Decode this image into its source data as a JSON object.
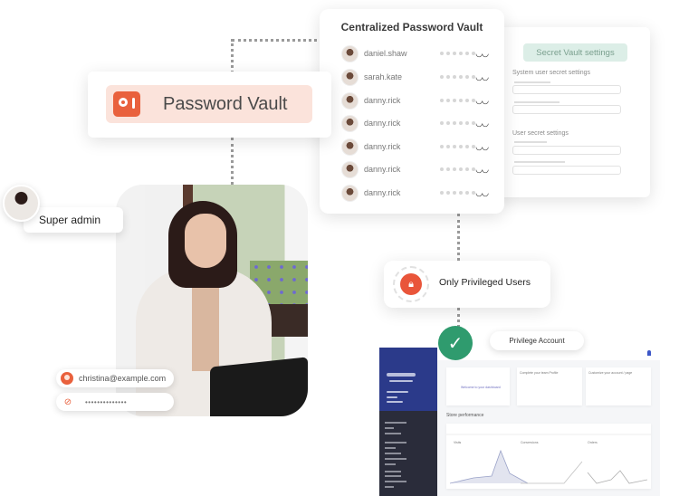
{
  "vault": {
    "title": "Centralized Password Vault",
    "entries": [
      {
        "username": "daniel.shaw",
        "password_mask": "••••••",
        "icon": "eye-closed-icon"
      },
      {
        "username": "sarah.kate",
        "password_mask": "••••••",
        "icon": "eye-closed-icon"
      },
      {
        "username": "danny.rick",
        "password_mask": "••••••",
        "icon": "eye-closed-icon"
      },
      {
        "username": "danny.rick",
        "password_mask": "••••••",
        "icon": "eye-closed-icon"
      },
      {
        "username": "danny.rick",
        "password_mask": "••••••",
        "icon": "eye-closed-icon"
      },
      {
        "username": "danny.rick",
        "password_mask": "••••••",
        "icon": "eye-closed-icon"
      },
      {
        "username": "danny.rick",
        "password_mask": "••••••",
        "icon": "eye-closed-icon"
      }
    ]
  },
  "settings": {
    "header": "Secret Vault settings",
    "system_section": "System user secret settings",
    "user_section": "User secret settings"
  },
  "password_vault": {
    "label": "Password Vault",
    "icon": "safe-icon",
    "accent": "#e9613d"
  },
  "super_admin": {
    "label": "Super admin"
  },
  "login": {
    "email": "christina@example.com",
    "password_mask": "••••••••••••••",
    "eye_icon": "eye-off-icon"
  },
  "privileged": {
    "label": "Only Privileged Users",
    "icon": "lock-icon"
  },
  "privilege_account": {
    "label": "Privilege Account",
    "check_color": "#2f9b6e"
  },
  "dashboard": {
    "welcome_tile": "Welcome to your dashboard",
    "tile_profile": "Complete your team Profile",
    "tile_account": "Customize your account / page",
    "section": "Store performance",
    "charts": [
      "Visits",
      "Conversions",
      "Orders"
    ]
  }
}
